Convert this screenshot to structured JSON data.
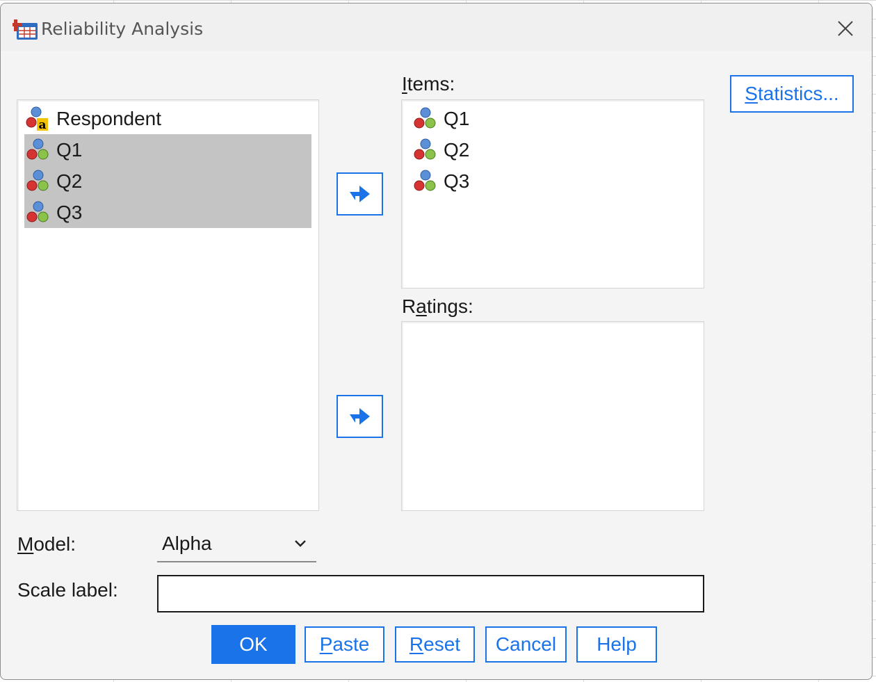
{
  "window": {
    "title": "Reliability Analysis"
  },
  "source_list": {
    "items": [
      {
        "label": "Respondent",
        "type": "string",
        "selected": false
      },
      {
        "label": "Q1",
        "type": "scale",
        "selected": true
      },
      {
        "label": "Q2",
        "type": "scale",
        "selected": true
      },
      {
        "label": "Q3",
        "type": "scale",
        "selected": true
      }
    ]
  },
  "items_section": {
    "label_prefix": "",
    "label_mnemonic": "I",
    "label_rest": "tems:",
    "items": [
      {
        "label": "Q1"
      },
      {
        "label": "Q2"
      },
      {
        "label": "Q3"
      }
    ]
  },
  "ratings_section": {
    "label_prefix": "R",
    "label_mnemonic": "a",
    "label_rest": "tings:"
  },
  "model": {
    "label_mnemonic": "M",
    "label_rest": "odel:",
    "selected": "Alpha"
  },
  "scale_label": {
    "label": "Scale label:",
    "value": ""
  },
  "buttons": {
    "statistics": {
      "mnemonic": "S",
      "rest": "tatistics..."
    },
    "ok": {
      "label": "OK"
    },
    "paste": {
      "mnemonic": "P",
      "rest": "aste"
    },
    "reset": {
      "mnemonic": "R",
      "rest": "eset"
    },
    "cancel": {
      "label": "Cancel"
    },
    "help": {
      "label": "Help"
    }
  },
  "colors": {
    "accent": "#1a73e8",
    "selection": "#c4c4c4",
    "dialog_bg": "#f4f4f4"
  }
}
